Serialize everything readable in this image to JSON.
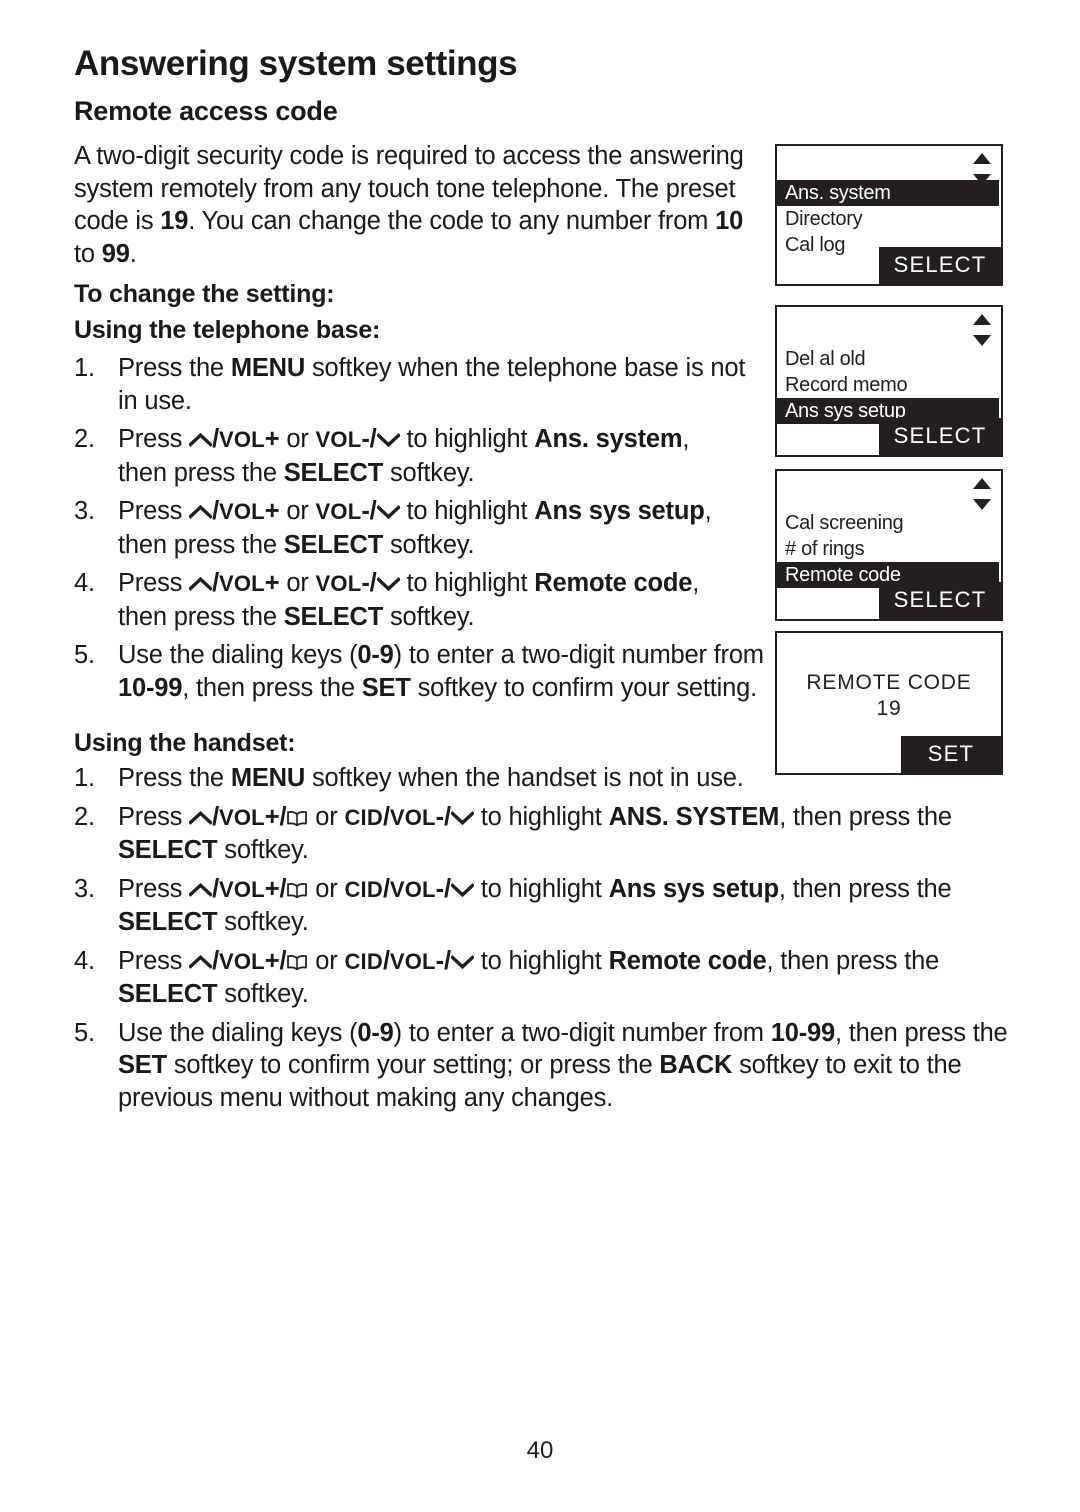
{
  "document": {
    "chapter_title": "Answering system settings",
    "section_title": "Remote access code",
    "page_number": "40"
  },
  "intro": {
    "t1": "A two-digit security code is required to access the answering system remotely from any touch tone telephone. The preset code is ",
    "b1": "19",
    "t2": ". You can change the code to any number from ",
    "b2": "10",
    "t3": " to ",
    "b3": "99",
    "t4": "."
  },
  "headings": {
    "to_change": "To change the setting:",
    "using_base": "Using the telephone base:",
    "using_handset": "Using the handset:"
  },
  "labels": {
    "press": "Press ",
    "press_the": "Press the ",
    "or": " or ",
    "to_highlight": " to highlight ",
    "then_press_the": "then press the ",
    "then_press_the_inline": ", then press the ",
    "softkey": " softkey.",
    "softkey_nodot": " softkey",
    "menu": "MENU",
    "select": "SELECT",
    "set": "SET",
    "back": "BACK",
    "vol_up": "VOL",
    "vol_plus": "+",
    "vol_dn": "VOL",
    "vol_minus": "-",
    "cid": "CID",
    "slash": "/",
    "ans_system": "Ans. system",
    "ans_system_caps": "ANS. SYSTEM",
    "ans_sys_setup": "Ans sys setup",
    "remote_code": "Remote code"
  },
  "base_steps": [
    {
      "num": "1.",
      "pre": "Press the ",
      "bold1": "MENU",
      "post": " softkey when the telephone base is not in use."
    },
    {
      "num": "2.",
      "target": "Ans. system",
      "tail_pre": "then press the ",
      "tail_bold": "SELECT",
      "tail_post": " softkey."
    },
    {
      "num": "3.",
      "target": "Ans sys setup",
      "tail_pre": "then press the ",
      "tail_bold": "SELECT",
      "tail_post": " softkey."
    },
    {
      "num": "4.",
      "target": "Remote code",
      "tail_pre": "then press the ",
      "tail_bold": "SELECT",
      "tail_post": " softkey."
    },
    {
      "num": "5.",
      "p1": "Use the dialing keys (",
      "b1": "0-9",
      "p2": ") to enter a two-digit number from ",
      "b2": "10-99",
      "p3": ", then press the ",
      "b3": "SET",
      "p4": " softkey to confirm your setting."
    }
  ],
  "handset_steps": [
    {
      "num": "1.",
      "pre": "Press the ",
      "bold1": "MENU",
      "post": " softkey when the handset is not in use."
    },
    {
      "num": "2.",
      "target": "ANS. SYSTEM",
      "tail_inline": ", then press the ",
      "tail_bold": "SELECT",
      "tail_post": " softkey."
    },
    {
      "num": "3.",
      "target": "Ans sys setup",
      "tail_inline": ", then press the ",
      "tail_bold": "SELECT",
      "tail_post": " softkey."
    },
    {
      "num": "4.",
      "target": "Remote code",
      "tail_inline": ", then press the ",
      "tail_bold": "SELECT",
      "tail_post": " softkey."
    },
    {
      "num": "5.",
      "p1": "Use the dialing keys (",
      "b1": "0-9",
      "p2": ") to enter a two-digit number from ",
      "b2": "10-99",
      "p3": ", then press the ",
      "b3": "SET",
      "p4": " softkey to confirm your setting; or press the ",
      "b4": "BACK",
      "p5": " softkey to exit to the previous menu without making any changes."
    }
  ],
  "lcd_screens": [
    {
      "name": "main-menu",
      "rows": [
        {
          "text": "Ans. system",
          "selected": true
        },
        {
          "text": "Directory",
          "selected": false
        },
        {
          "text": "Cal log",
          "selected": false
        }
      ],
      "softkey": "SELECT"
    },
    {
      "name": "ans-system-menu",
      "rows": [
        {
          "text": "Del al old",
          "selected": false
        },
        {
          "text": "Record memo",
          "selected": false
        },
        {
          "text": "Ans sys setup",
          "selected": true
        }
      ],
      "softkey": "SELECT"
    },
    {
      "name": "ans-sys-setup-menu",
      "rows": [
        {
          "text": "Cal screening",
          "selected": false
        },
        {
          "text": "# of rings",
          "selected": false
        },
        {
          "text": "Remote code",
          "selected": true
        }
      ],
      "softkey": "SELECT"
    },
    {
      "name": "remote-code-entry",
      "title": "REMOTE CODE",
      "value": "19",
      "softkey": "SET"
    }
  ],
  "colors": {
    "ink": "#231f20",
    "lcd_background": "#ffffff"
  }
}
